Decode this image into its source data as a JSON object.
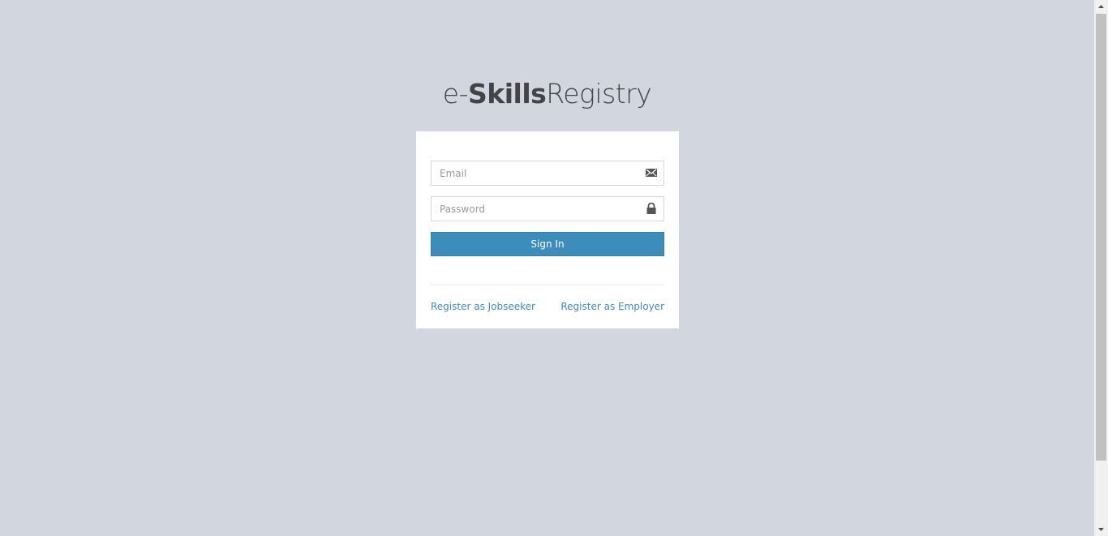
{
  "logo": {
    "prefix": "e-",
    "bold": "Skills",
    "suffix": "Registry"
  },
  "form": {
    "email_placeholder": "Email",
    "password_placeholder": "Password",
    "email_icon": "envelope-icon",
    "password_icon": "lock-icon",
    "submit_label": "Sign In"
  },
  "links": {
    "jobseeker": "Register as Jobseeker",
    "employer": "Register as Employer"
  },
  "colors": {
    "background": "#d2d6de",
    "primary": "#3c8dbc",
    "box": "#ffffff"
  }
}
